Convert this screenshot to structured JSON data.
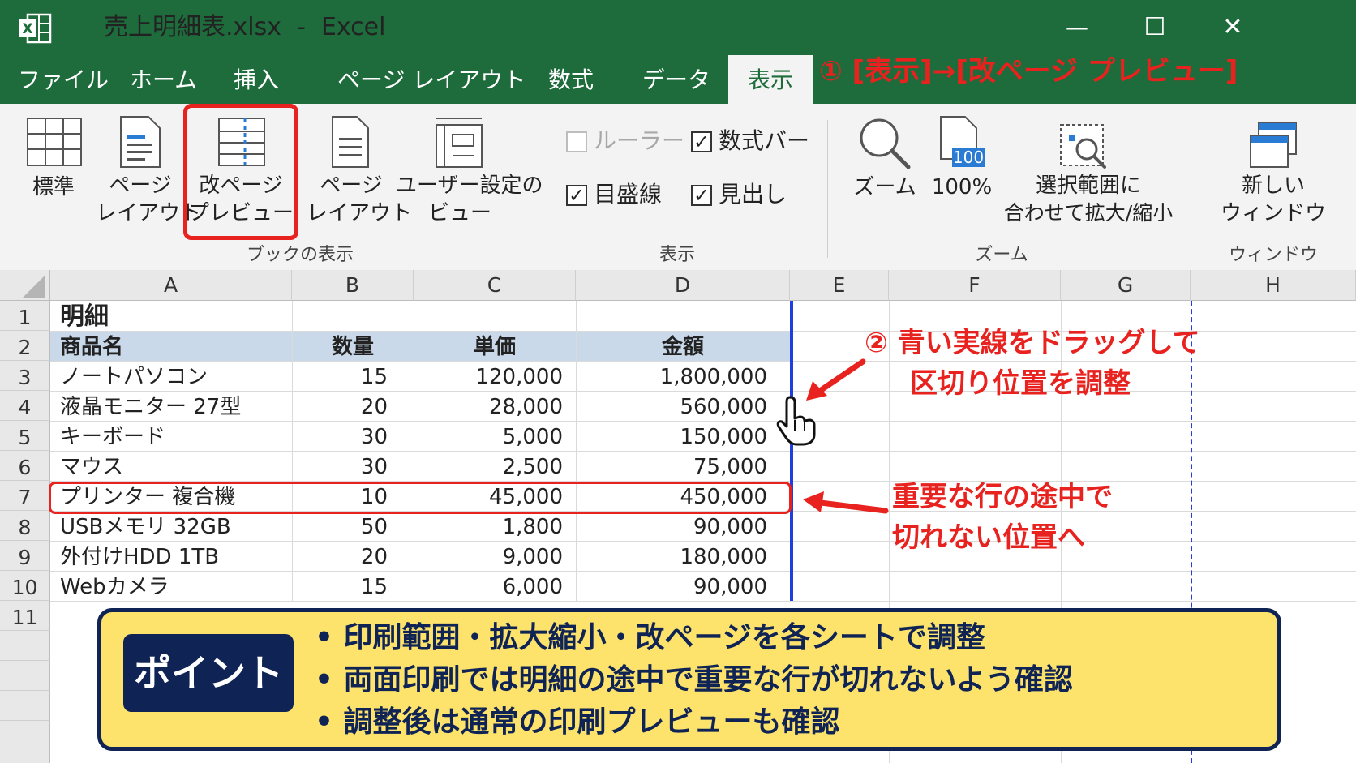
{
  "window": {
    "title": "売上明細表.xlsx  -  Excel",
    "minimize": "—",
    "maximize": "☐",
    "close": "✕"
  },
  "tabs": [
    "ファイル",
    "ホーム",
    "挿入",
    "ページ レイアウト",
    "数式",
    "データ",
    "表示"
  ],
  "active_tab": "表示",
  "ribbon": {
    "book_views": {
      "label": "ブックの表示",
      "buttons": [
        {
          "line1": "標準",
          "line2": ""
        },
        {
          "line1": "ページ",
          "line2": "レイアウト"
        },
        {
          "line1": "改ページ",
          "line2": "プレビュー"
        },
        {
          "line1": "ページ",
          "line2": "レイアウト"
        },
        {
          "line1": "ユーザー設定の",
          "line2": "ビュー"
        }
      ]
    },
    "show": {
      "label": "表示",
      "ruler": "ルーラー",
      "formula_bar": "数式バー",
      "gridlines": "目盛線",
      "headings": "見出し"
    },
    "zoom": {
      "label": "ズーム",
      "zoom": "ズーム",
      "hundred": "100%",
      "hundred_badge": "100",
      "zoom_to_selection_line1": "選択範囲に",
      "zoom_to_selection_line2": "合わせて拡大/縮小"
    },
    "window": {
      "label": "ウィンドウ",
      "new_window_line1": "新しい",
      "new_window_line2": "ウィンドウ"
    }
  },
  "columns": [
    "A",
    "B",
    "C",
    "D",
    "E",
    "F",
    "G",
    "H"
  ],
  "rows": [
    "1",
    "2",
    "3",
    "4",
    "5",
    "6",
    "7",
    "8",
    "9",
    "10",
    "11"
  ],
  "sheet": {
    "title": "明細",
    "headers": [
      "商品名",
      "数量",
      "単価",
      "金額"
    ],
    "data": [
      [
        "ノートパソコン",
        "15",
        "120,000",
        "1,800,000"
      ],
      [
        "液晶モニター 27型",
        "20",
        "28,000",
        "560,000"
      ],
      [
        "キーボード",
        "30",
        "5,000",
        "150,000"
      ],
      [
        "マウス",
        "30",
        "2,500",
        "75,000"
      ],
      [
        "プリンター 複合機",
        "10",
        "45,000",
        "450,000"
      ],
      [
        "USBメモリ 32GB",
        "50",
        "1,800",
        "90,000"
      ],
      [
        "外付けHDD 1TB",
        "20",
        "9,000",
        "180,000"
      ],
      [
        "Webカメラ",
        "15",
        "6,000",
        "90,000"
      ]
    ]
  },
  "annotations": {
    "step1": "① [表示]→[改ページ プレビュー]",
    "step2_line1": "② 青い実線をドラッグして",
    "step2_line2": "区切り位置を調整",
    "row_note_line1": "重要な行の途中で",
    "row_note_line2": "切れない位置へ"
  },
  "point": {
    "badge": "ポイント",
    "lines": [
      "• 印刷範囲・拡大縮小・改ページを各シートで調整",
      "• 両面印刷では明細の途中で重要な行が切れないよう確認",
      "• 調整後は通常の印刷プレビューも確認"
    ]
  },
  "colors": {
    "excel_green": "#1e6b3c",
    "header_fill": "#c9d9ea",
    "accent_red": "#e8221e",
    "page_break_blue": "#1f3ee0",
    "point_fill": "#fde36b",
    "point_navy": "#0f2454"
  }
}
